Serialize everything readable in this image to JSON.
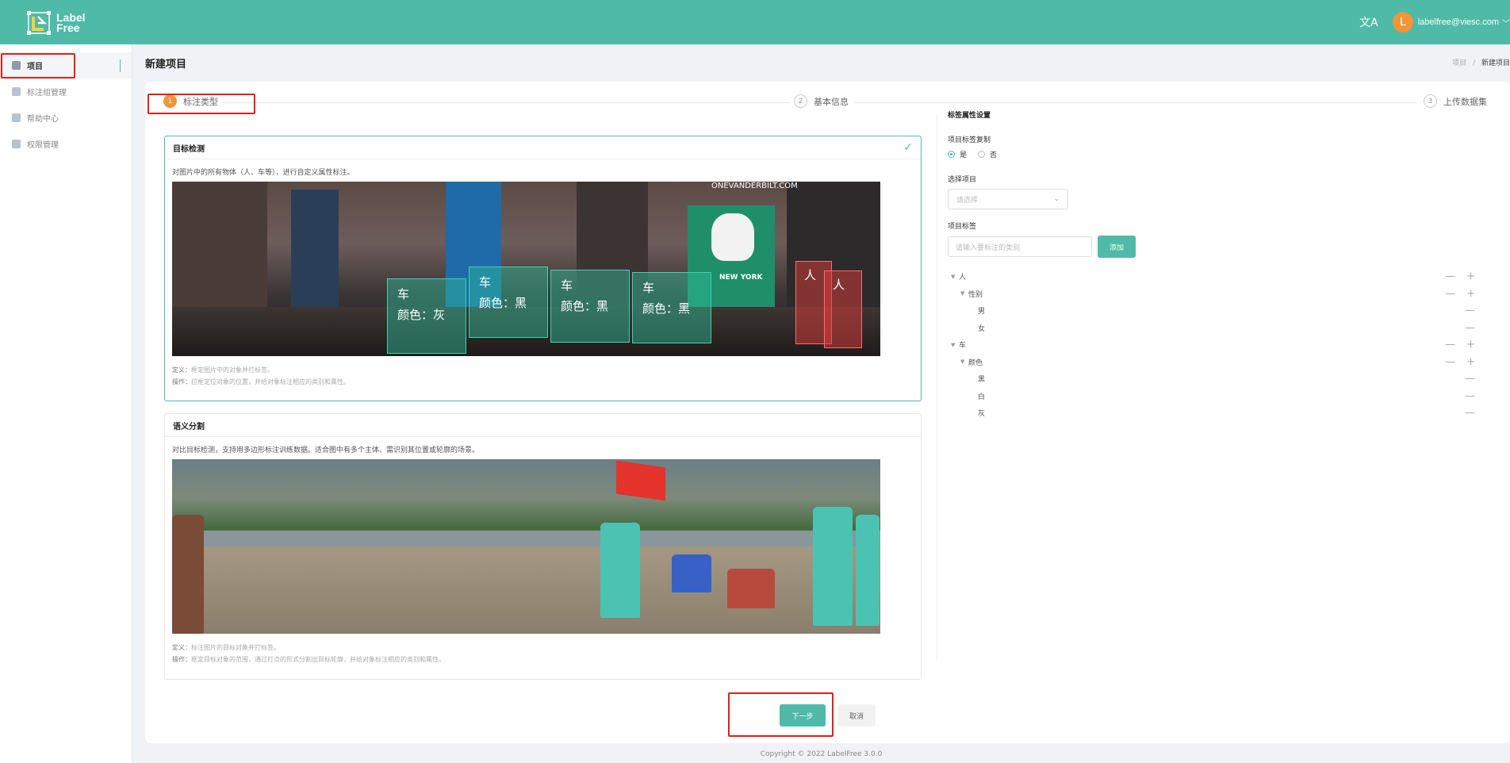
{
  "app": {
    "logo_line1": "Label",
    "logo_line2": "Free"
  },
  "header": {
    "translate_icon": "translate-icon",
    "avatar_letter": "L",
    "user_email": "labelfree@viesc.com"
  },
  "sidebar": {
    "items": [
      {
        "label": "项目",
        "icon": "project-icon",
        "active": true
      },
      {
        "label": "标注组管理",
        "icon": "team-icon",
        "active": false
      },
      {
        "label": "帮助中心",
        "icon": "help-icon",
        "active": false
      },
      {
        "label": "权限管理",
        "icon": "user-icon",
        "active": false
      }
    ]
  },
  "page": {
    "title": "新建项目",
    "breadcrumb": [
      "项目",
      "新建项目"
    ]
  },
  "steps": [
    {
      "num": "1",
      "label": "标注类型",
      "active": true
    },
    {
      "num": "2",
      "label": "基本信息",
      "active": false
    },
    {
      "num": "3",
      "label": "上传数据集",
      "active": false
    }
  ],
  "annotation_types": [
    {
      "title": "目标检测",
      "selected": true,
      "desc": "对图片中的所有物体（人、车等），进行自定义属性标注。",
      "def_label": "定义：",
      "def_text": "框定图片中的对象并打标签。",
      "op_label": "操作：",
      "op_text": "拉框定位对象的位置，并给对象标注相应的类别和属性。",
      "image_labels": {
        "cars": [
          {
            "title": "车",
            "attr": "颜色：灰"
          },
          {
            "title": "车",
            "attr": "颜色：黑"
          },
          {
            "title": "车",
            "attr": "颜色：黑"
          },
          {
            "title": "车",
            "attr": "颜色：黑"
          }
        ],
        "persons": [
          "人",
          "人"
        ],
        "sign_text": "ONEVANDERBILT.COM",
        "sign_text2": "NEW YORK"
      }
    },
    {
      "title": "语义分割",
      "selected": false,
      "desc": "对比目标检测，支持用多边形标注训练数据。适合图中有多个主体、需识别其位置或轮廓的场景。",
      "def_label": "定义：",
      "def_text": "标注图片的目标对象并打标签。",
      "op_label": "操作：",
      "op_text": "框定目标对象的范围，通过打点的形式分割出目标轮廓，并给对象标注相应的类别和属性。"
    }
  ],
  "properties": {
    "title": "标签属性设置",
    "reuse_label": "项目标签复制",
    "reuse_yes": "是",
    "reuse_no": "否",
    "reuse_value": "是",
    "project_label": "选择项目",
    "project_placeholder": "请选择",
    "tags_label": "项目标签",
    "tag_placeholder": "请输入要标注的类别",
    "add_button": "添加",
    "tree": [
      {
        "label": "人",
        "level": 0,
        "caret": true,
        "controls": "both"
      },
      {
        "label": "性别",
        "level": 1,
        "caret": true,
        "controls": "both"
      },
      {
        "label": "男",
        "level": 2,
        "caret": false,
        "controls": "minus"
      },
      {
        "label": "女",
        "level": 2,
        "caret": false,
        "controls": "minus"
      },
      {
        "label": "车",
        "level": 0,
        "caret": true,
        "controls": "both"
      },
      {
        "label": "颜色",
        "level": 1,
        "caret": true,
        "controls": "both"
      },
      {
        "label": "黑",
        "level": 2,
        "caret": false,
        "controls": "minus"
      },
      {
        "label": "白",
        "level": 2,
        "caret": false,
        "controls": "minus"
      },
      {
        "label": "灰",
        "level": 2,
        "caret": false,
        "controls": "minus"
      }
    ]
  },
  "actions": {
    "next": "下一步",
    "cancel": "取消"
  },
  "footer": {
    "copyright": "Copyright © 2022 LabelFree 3.0.0"
  },
  "colors": {
    "brand": "#4fbaa8",
    "step_active": "#f0953a",
    "highlight_box": "#e0201b"
  }
}
